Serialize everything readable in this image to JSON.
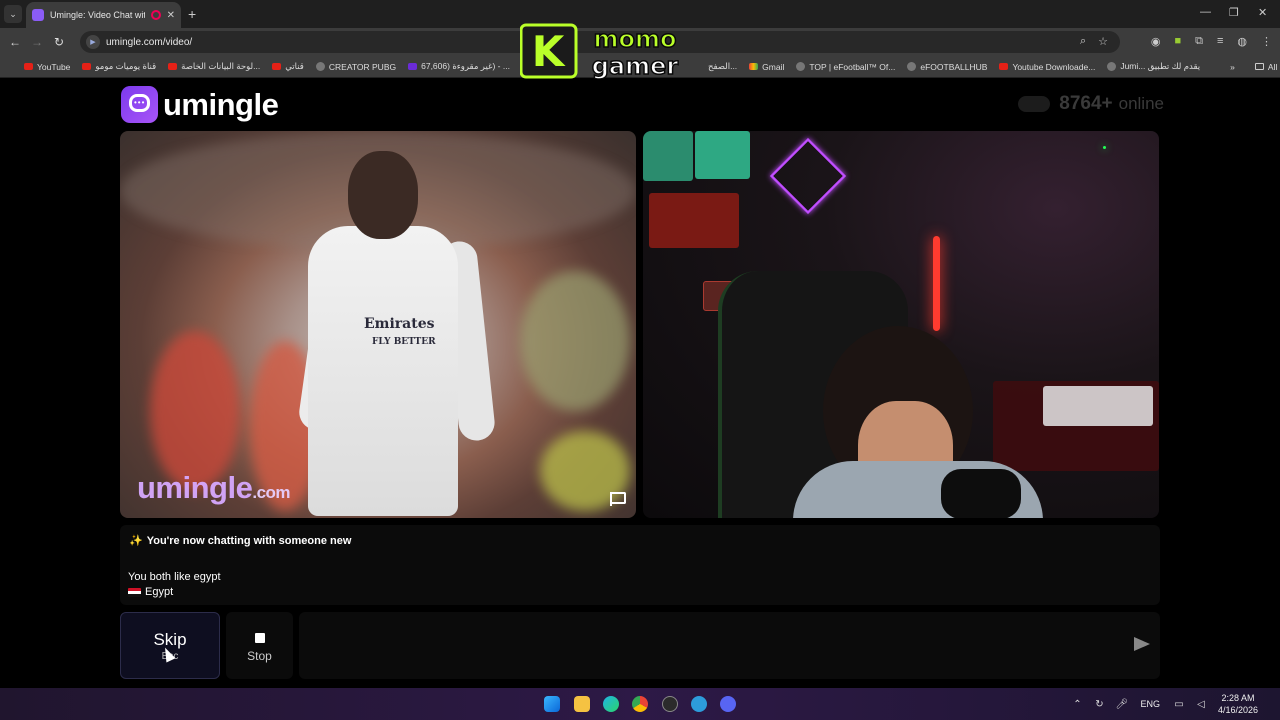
{
  "browser": {
    "tab_title": "Umingle: Video Chat with S",
    "url": "umingle.com/video/",
    "bookmarks": [
      "YouTube",
      "قناة يوميات مومو",
      "لوحة البيانات الخاصة...",
      "قناتي",
      "CREATOR PUBG",
      "67,606) غير مقروءة) - ...",
      "الصفح...",
      "Gmail",
      "TOP | eFootball™ Of...",
      "eFOOTBALLHUB",
      "Youtube Downloade...",
      "Jumi... يقدم لك تطبيق"
    ],
    "all_bookmarks": "All Bookmarks"
  },
  "overlay": {
    "logo_line1": "momo",
    "logo_line2": "gamer",
    "logo_letter": "K"
  },
  "site": {
    "brand": "umingle",
    "online_count": "8764+",
    "online_label": "online",
    "watermark_main": "umingle",
    "watermark_suffix": ".com",
    "sponsor_line1": "Emirates",
    "sponsor_line2": "FLY BETTER"
  },
  "chat": {
    "system_message": "You're now chatting with someone new",
    "common_interest": "You both like egypt",
    "country": "Egypt"
  },
  "controls": {
    "skip_label": "Skip",
    "skip_hint": "Esc",
    "stop_label": "Stop",
    "message_placeholder": ""
  },
  "taskbar": {
    "language": "ENG",
    "time": "2:28 AM",
    "date": "4/16/2026"
  },
  "colors": {
    "brand_purple": "#8b5cf6",
    "watermark_purple": "#d7a9ff",
    "skip_bg": "#0e0e20"
  }
}
